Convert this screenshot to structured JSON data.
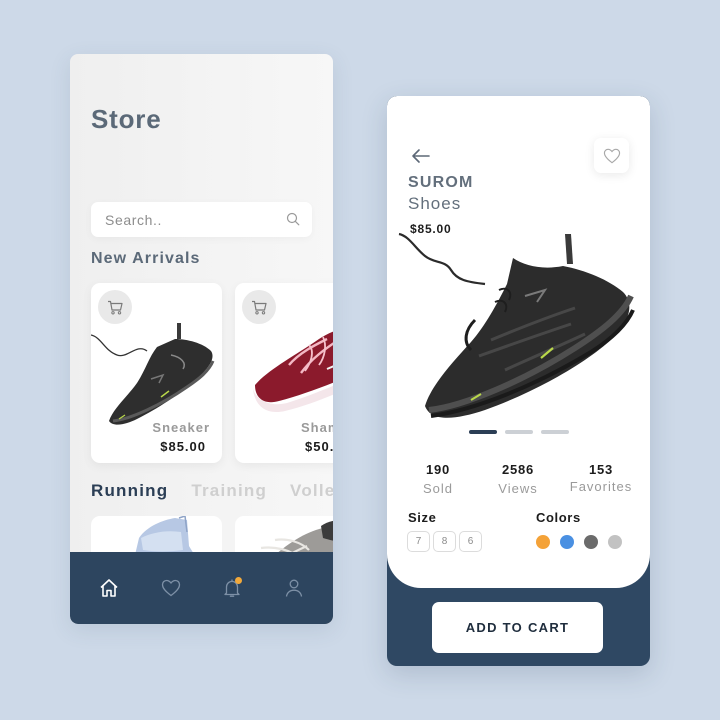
{
  "store": {
    "title": "Store",
    "search": {
      "placeholder": "Search..",
      "value": ""
    },
    "new_arrivals_title": "New Arrivals",
    "products": [
      {
        "name": "Sneaker",
        "price": "$85.00",
        "image": "black-running-sneaker"
      },
      {
        "name": "Sham",
        "price": "$50.",
        "image": "burgundy-skate-shoe"
      }
    ],
    "tabs": [
      {
        "label": "Running",
        "active": true
      },
      {
        "label": "Training",
        "active": false
      },
      {
        "label": "Volle",
        "active": false
      }
    ],
    "running_products": [
      {
        "image": "light-blue-high-top-sneaker"
      },
      {
        "image": "grey-worn-sneaker"
      }
    ],
    "bottom_nav": [
      {
        "icon": "home-icon",
        "active": true
      },
      {
        "icon": "heart-icon",
        "active": false
      },
      {
        "icon": "bell-icon",
        "active": false,
        "badge": true
      },
      {
        "icon": "user-icon",
        "active": false
      }
    ]
  },
  "detail": {
    "brand": "SUROM",
    "category": "Shoes",
    "price": "$85.00",
    "image": "black-running-sneaker",
    "carousel": {
      "count": 3,
      "active_index": 0
    },
    "stats": [
      {
        "value": "190",
        "label": "Sold"
      },
      {
        "value": "2586",
        "label": "Views"
      },
      {
        "value": "153",
        "label": "Favorites"
      }
    ],
    "size_label": "Size",
    "sizes": [
      "7",
      "8",
      "6"
    ],
    "colors_label": "Colors",
    "colors": [
      "#f4a238",
      "#4a90e2",
      "#6b6b6b",
      "#c2c2c2"
    ],
    "add_to_cart_label": "ADD TO CART"
  },
  "theme": {
    "background": "#cdd9e8",
    "navy": "#2d455f",
    "accent": "#f2a93b"
  }
}
